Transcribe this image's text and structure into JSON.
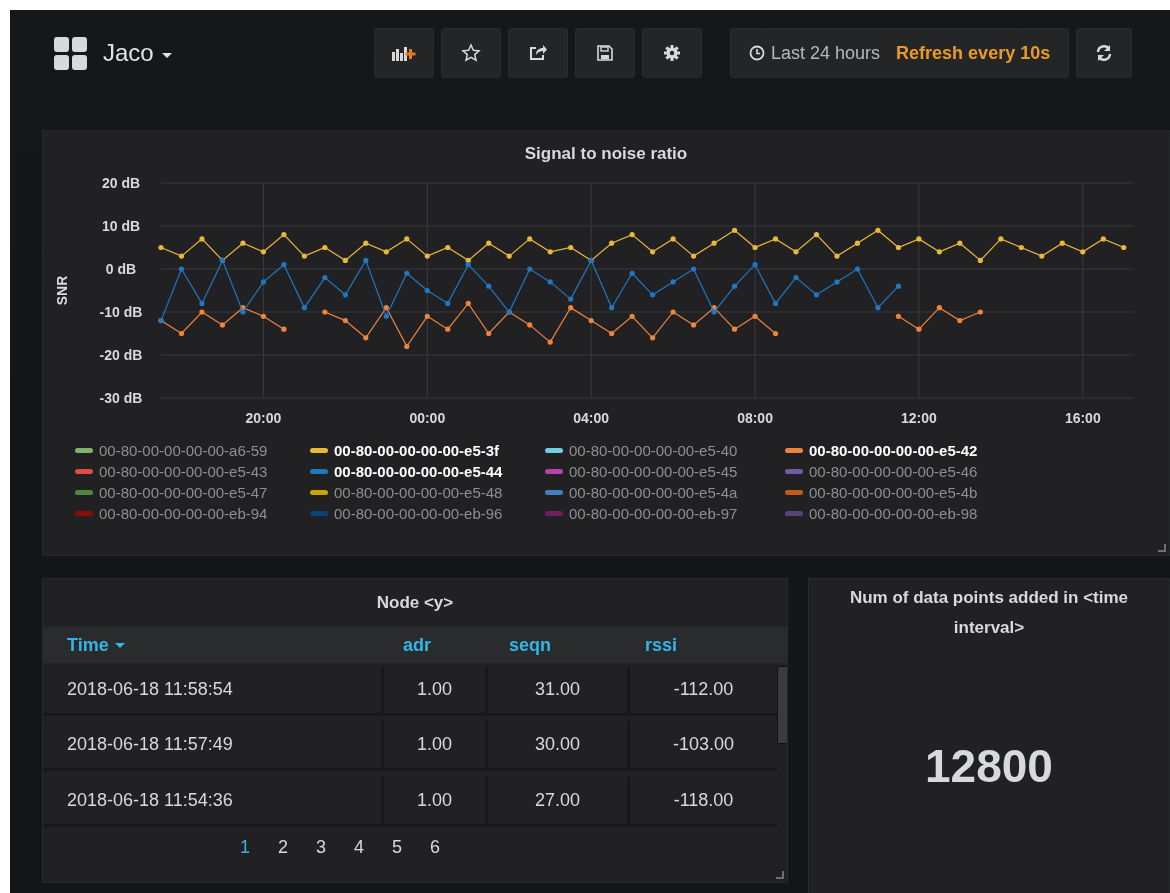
{
  "header": {
    "dashboard_title": "Jaco",
    "time_range": "Last 24 hours",
    "refresh": "Refresh every 10s"
  },
  "snr_panel": {
    "chart_data": {
      "type": "line",
      "title": "Signal to noise ratio",
      "ylabel": "SNR",
      "x": [
        "2018-06-17T17:30",
        "2018-06-17T18:00",
        "2018-06-17T18:30",
        "2018-06-17T19:00",
        "2018-06-17T19:30",
        "2018-06-17T20:00",
        "2018-06-17T20:30",
        "2018-06-17T21:00",
        "2018-06-17T21:30",
        "2018-06-17T22:00",
        "2018-06-17T22:30",
        "2018-06-17T23:00",
        "2018-06-17T23:30",
        "2018-06-18T00:00",
        "2018-06-18T00:30",
        "2018-06-18T01:00",
        "2018-06-18T01:30",
        "2018-06-18T02:00",
        "2018-06-18T02:30",
        "2018-06-18T03:00",
        "2018-06-18T03:30",
        "2018-06-18T04:00",
        "2018-06-18T04:30",
        "2018-06-18T05:00",
        "2018-06-18T05:30",
        "2018-06-18T06:00",
        "2018-06-18T06:30",
        "2018-06-18T07:00",
        "2018-06-18T07:30",
        "2018-06-18T08:00",
        "2018-06-18T08:30",
        "2018-06-18T09:00",
        "2018-06-18T09:30",
        "2018-06-18T10:00",
        "2018-06-18T10:30",
        "2018-06-18T11:00",
        "2018-06-18T11:30",
        "2018-06-18T12:00",
        "2018-06-18T12:30",
        "2018-06-18T13:00",
        "2018-06-18T13:30",
        "2018-06-18T14:00",
        "2018-06-18T14:30",
        "2018-06-18T15:00",
        "2018-06-18T15:30",
        "2018-06-18T16:00",
        "2018-06-18T16:30",
        "2018-06-18T17:00"
      ],
      "xlim": [
        "2018-06-17T17:30",
        "2018-06-18T17:15"
      ],
      "ylim": [
        -30,
        20
      ],
      "grid": true,
      "xticks": [
        {
          "value": "2018-06-17T20:00",
          "label": "20:00"
        },
        {
          "value": "2018-06-18T00:00",
          "label": "00:00"
        },
        {
          "value": "2018-06-18T04:00",
          "label": "04:00"
        },
        {
          "value": "2018-06-18T08:00",
          "label": "08:00"
        },
        {
          "value": "2018-06-18T12:00",
          "label": "12:00"
        },
        {
          "value": "2018-06-18T16:00",
          "label": "16:00"
        }
      ],
      "yticks": [
        {
          "value": 20,
          "label": "20 dB"
        },
        {
          "value": 10,
          "label": "10 dB"
        },
        {
          "value": 0,
          "label": "0 dB"
        },
        {
          "value": -10,
          "label": "-10 dB"
        },
        {
          "value": -20,
          "label": "-20 dB"
        },
        {
          "value": -30,
          "label": "-30 dB"
        }
      ],
      "series": [
        {
          "name": "00-80-00-00-00-00-a6-59",
          "color": "#7eb26d",
          "values": [
            null,
            null,
            null,
            null,
            null,
            null,
            null,
            null,
            null,
            null,
            null,
            null,
            null,
            null,
            null,
            null,
            null,
            null,
            null,
            null,
            null,
            null,
            null,
            null,
            null,
            null,
            null,
            null,
            null,
            null,
            null,
            null,
            null,
            null,
            null,
            null,
            null,
            null,
            null,
            null,
            null,
            null,
            null,
            null,
            null,
            null,
            null,
            null
          ]
        },
        {
          "name": "00-80-00-00-00-00-e5-3f",
          "color": "#eab839",
          "values": [
            5,
            3,
            7,
            2,
            6,
            4,
            8,
            3,
            5,
            2,
            6,
            4,
            7,
            3,
            5,
            2,
            6,
            3,
            7,
            4,
            5,
            2,
            6,
            8,
            4,
            7,
            3,
            6,
            9,
            5,
            7,
            4,
            8,
            3,
            6,
            9,
            5,
            7,
            4,
            6,
            2,
            7,
            5,
            3,
            6,
            4,
            7,
            5
          ]
        },
        {
          "name": "00-80-00-00-00-00-e5-40",
          "color": "#6ed0e0",
          "values": [
            null,
            null,
            null,
            null,
            null,
            null,
            null,
            null,
            null,
            null,
            null,
            null,
            null,
            null,
            null,
            null,
            null,
            null,
            null,
            null,
            null,
            null,
            null,
            null,
            null,
            null,
            null,
            null,
            null,
            null,
            null,
            null,
            null,
            null,
            null,
            null,
            null,
            null,
            null,
            null,
            null,
            null,
            null,
            null,
            null,
            null,
            null,
            null
          ]
        },
        {
          "name": "00-80-00-00-00-00-e5-42",
          "color": "#ef843c",
          "values": [
            -12,
            -15,
            -10,
            -13,
            -9,
            -11,
            -14,
            null,
            -10,
            -12,
            -16,
            -9,
            -18,
            -11,
            -14,
            -8,
            -15,
            -10,
            -13,
            -17,
            -9,
            -12,
            -15,
            -11,
            -16,
            -10,
            -13,
            -9,
            -14,
            -11,
            -15,
            null,
            null,
            null,
            null,
            null,
            -11,
            -14,
            -9,
            -12,
            -10,
            null,
            null,
            null,
            null,
            null,
            null,
            null
          ]
        },
        {
          "name": "00-80-00-00-00-00-e5-43",
          "color": "#e24d42",
          "values": [
            null,
            null,
            null,
            null,
            null,
            null,
            null,
            null,
            null,
            null,
            null,
            null,
            null,
            null,
            null,
            null,
            null,
            null,
            null,
            null,
            null,
            null,
            null,
            null,
            null,
            null,
            null,
            null,
            null,
            null,
            null,
            null,
            null,
            null,
            null,
            null,
            null,
            null,
            null,
            null,
            null,
            null,
            null,
            null,
            null,
            null,
            null,
            null
          ]
        },
        {
          "name": "00-80-00-00-00-00-e5-44",
          "color": "#1f78c1",
          "values": [
            -12,
            0,
            -8,
            2,
            -10,
            -3,
            1,
            -9,
            -2,
            -6,
            2,
            -11,
            -1,
            -5,
            -8,
            1,
            -4,
            -10,
            0,
            -3,
            -7,
            2,
            -9,
            -1,
            -6,
            -3,
            0,
            -10,
            -4,
            1,
            -8,
            -2,
            -6,
            -3,
            0,
            -9,
            -4,
            null,
            null,
            null,
            null,
            null,
            null,
            null,
            null,
            null,
            null,
            null
          ]
        },
        {
          "name": "00-80-00-00-00-00-e5-45",
          "color": "#ba43a9",
          "values": [
            null,
            null,
            null,
            null,
            null,
            null,
            null,
            null,
            null,
            null,
            null,
            null,
            null,
            null,
            null,
            null,
            null,
            null,
            null,
            null,
            null,
            null,
            null,
            null,
            null,
            null,
            null,
            null,
            null,
            null,
            null,
            null,
            null,
            null,
            null,
            null,
            null,
            null,
            null,
            null,
            null,
            null,
            null,
            null,
            null,
            null,
            null,
            null
          ]
        },
        {
          "name": "00-80-00-00-00-00-e5-46",
          "color": "#705da0",
          "values": [
            null,
            null,
            null,
            null,
            null,
            null,
            null,
            null,
            null,
            null,
            null,
            null,
            null,
            null,
            null,
            null,
            null,
            null,
            null,
            null,
            null,
            null,
            null,
            null,
            null,
            null,
            null,
            null,
            null,
            null,
            null,
            null,
            null,
            null,
            null,
            null,
            null,
            null,
            null,
            null,
            null,
            null,
            null,
            null,
            null,
            null,
            null,
            null
          ]
        },
        {
          "name": "00-80-00-00-00-00-e5-47",
          "color": "#508642",
          "values": [
            null,
            null,
            null,
            null,
            null,
            null,
            null,
            null,
            null,
            null,
            null,
            null,
            null,
            null,
            null,
            null,
            null,
            null,
            null,
            null,
            null,
            null,
            null,
            null,
            null,
            null,
            null,
            null,
            null,
            null,
            null,
            null,
            null,
            null,
            null,
            null,
            null,
            null,
            null,
            null,
            null,
            null,
            null,
            null,
            null,
            null,
            null,
            null
          ]
        },
        {
          "name": "00-80-00-00-00-00-e5-48",
          "color": "#cca300",
          "values": [
            null,
            null,
            null,
            null,
            null,
            null,
            null,
            null,
            null,
            null,
            null,
            null,
            null,
            null,
            null,
            null,
            null,
            null,
            null,
            null,
            null,
            null,
            null,
            null,
            null,
            null,
            null,
            null,
            null,
            null,
            null,
            null,
            null,
            null,
            null,
            null,
            null,
            null,
            null,
            null,
            null,
            null,
            null,
            null,
            null,
            null,
            null,
            null
          ]
        },
        {
          "name": "00-80-00-00-00-00-e5-4a",
          "color": "#447ebc",
          "values": [
            null,
            null,
            null,
            null,
            null,
            null,
            null,
            null,
            null,
            null,
            null,
            null,
            null,
            null,
            null,
            null,
            null,
            null,
            null,
            null,
            null,
            null,
            null,
            null,
            null,
            null,
            null,
            null,
            null,
            null,
            null,
            null,
            null,
            null,
            null,
            null,
            null,
            null,
            null,
            null,
            null,
            null,
            null,
            null,
            null,
            null,
            null,
            null
          ]
        },
        {
          "name": "00-80-00-00-00-00-e5-4b",
          "color": "#c15c17",
          "values": [
            null,
            null,
            null,
            null,
            null,
            null,
            null,
            null,
            null,
            null,
            null,
            null,
            null,
            null,
            null,
            null,
            null,
            null,
            null,
            null,
            null,
            null,
            null,
            null,
            null,
            null,
            null,
            null,
            null,
            null,
            null,
            null,
            null,
            null,
            null,
            null,
            null,
            null,
            null,
            null,
            null,
            null,
            null,
            null,
            null,
            null,
            null,
            null
          ]
        },
        {
          "name": "00-80-00-00-00-00-eb-94",
          "color": "#890f02",
          "values": [
            null,
            null,
            null,
            null,
            null,
            null,
            null,
            null,
            null,
            null,
            null,
            null,
            null,
            null,
            null,
            null,
            null,
            null,
            null,
            null,
            null,
            null,
            null,
            null,
            null,
            null,
            null,
            null,
            null,
            null,
            null,
            null,
            null,
            null,
            null,
            null,
            null,
            null,
            null,
            null,
            null,
            null,
            null,
            null,
            null,
            null,
            null,
            null
          ]
        },
        {
          "name": "00-80-00-00-00-00-eb-96",
          "color": "#0a437c",
          "values": [
            null,
            null,
            null,
            null,
            null,
            null,
            null,
            null,
            null,
            null,
            null,
            null,
            null,
            null,
            null,
            null,
            null,
            null,
            null,
            null,
            null,
            null,
            null,
            null,
            null,
            null,
            null,
            null,
            null,
            null,
            null,
            null,
            null,
            null,
            null,
            null,
            null,
            null,
            null,
            null,
            null,
            null,
            null,
            null,
            null,
            null,
            null,
            null
          ]
        },
        {
          "name": "00-80-00-00-00-00-eb-97",
          "color": "#6d1f62",
          "values": [
            null,
            null,
            null,
            null,
            null,
            null,
            null,
            null,
            null,
            null,
            null,
            null,
            null,
            null,
            null,
            null,
            null,
            null,
            null,
            null,
            null,
            null,
            null,
            null,
            null,
            null,
            null,
            null,
            null,
            null,
            null,
            null,
            null,
            null,
            null,
            null,
            null,
            null,
            null,
            null,
            null,
            null,
            null,
            null,
            null,
            null,
            null,
            null
          ]
        },
        {
          "name": "00-80-00-00-00-00-eb-98",
          "color": "#584477",
          "values": [
            null,
            null,
            null,
            null,
            null,
            null,
            null,
            null,
            null,
            null,
            null,
            null,
            null,
            null,
            null,
            null,
            null,
            null,
            null,
            null,
            null,
            null,
            null,
            null,
            null,
            null,
            null,
            null,
            null,
            null,
            null,
            null,
            null,
            null,
            null,
            null,
            null,
            null,
            null,
            null,
            null,
            null,
            null,
            null,
            null,
            null,
            null,
            null
          ]
        }
      ]
    }
  },
  "table_panel": {
    "title": "Node <y>",
    "columns": [
      {
        "label": "Time",
        "sorted": true
      },
      {
        "label": "adr",
        "sorted": false
      },
      {
        "label": "seqn",
        "sorted": false
      },
      {
        "label": "rssi",
        "sorted": false
      }
    ],
    "rows": [
      [
        "2018-06-18 11:58:54",
        "1.00",
        "31.00",
        "-112.00"
      ],
      [
        "2018-06-18 11:57:49",
        "1.00",
        "30.00",
        "-103.00"
      ],
      [
        "2018-06-18 11:54:36",
        "1.00",
        "27.00",
        "-118.00"
      ]
    ],
    "pages": [
      {
        "label": "1",
        "selected": true
      },
      {
        "label": "2",
        "selected": false
      },
      {
        "label": "3",
        "selected": false
      },
      {
        "label": "4",
        "selected": false
      },
      {
        "label": "5",
        "selected": false
      },
      {
        "label": "6",
        "selected": false
      }
    ]
  },
  "stat_panel": {
    "title": "Num of data points added in <time interval>",
    "value": "12800"
  }
}
